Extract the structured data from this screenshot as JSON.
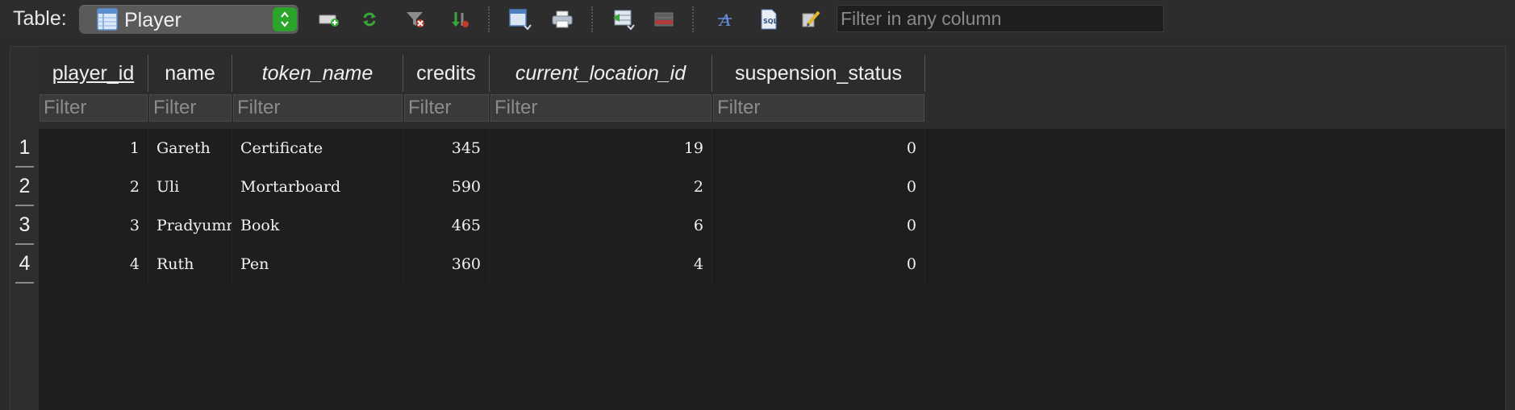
{
  "toolbar": {
    "table_label": "Table:",
    "selected_table": "Player",
    "filter_placeholder": "Filter in any column",
    "buttons": [
      {
        "name": "new-record-icon"
      },
      {
        "name": "refresh-icon"
      },
      {
        "name": "clear-filters-icon"
      },
      {
        "name": "sort-icon"
      },
      {
        "name": "save-table-icon"
      },
      {
        "name": "print-icon"
      },
      {
        "name": "insert-record-icon"
      },
      {
        "name": "delete-record-icon"
      },
      {
        "name": "text-style-icon"
      },
      {
        "name": "export-icon"
      },
      {
        "name": "edit-display-icon"
      }
    ]
  },
  "grid": {
    "columns": [
      {
        "key": "player_id",
        "label": "player_id",
        "kind": "pk",
        "filter": "Filter"
      },
      {
        "key": "name",
        "label": "name",
        "kind": "plain",
        "filter": "Filter"
      },
      {
        "key": "token_name",
        "label": "token_name",
        "kind": "fk",
        "filter": "Filter"
      },
      {
        "key": "credits",
        "label": "credits",
        "kind": "plain",
        "filter": "Filter"
      },
      {
        "key": "current_location_id",
        "label": "current_location_id",
        "kind": "fk",
        "filter": "Filter"
      },
      {
        "key": "suspension_status",
        "label": "suspension_status",
        "kind": "plain",
        "filter": "Filter"
      }
    ],
    "rows": [
      {
        "rownum": "1",
        "player_id": "1",
        "name": "Gareth",
        "token_name": "Certificate",
        "credits": "345",
        "current_location_id": "19",
        "suspension_status": "0"
      },
      {
        "rownum": "2",
        "player_id": "2",
        "name": "Uli",
        "token_name": "Mortarboard",
        "credits": "590",
        "current_location_id": "2",
        "suspension_status": "0"
      },
      {
        "rownum": "3",
        "player_id": "3",
        "name": "Pradyumn",
        "token_name": "Book",
        "credits": "465",
        "current_location_id": "6",
        "suspension_status": "0"
      },
      {
        "rownum": "4",
        "player_id": "4",
        "name": "Ruth",
        "token_name": "Pen",
        "credits": "360",
        "current_location_id": "4",
        "suspension_status": "0"
      }
    ]
  },
  "colors": {
    "background": "#2b2b2b",
    "grid_background": "#1e1e1e",
    "stepper_green": "#2aa52a"
  }
}
